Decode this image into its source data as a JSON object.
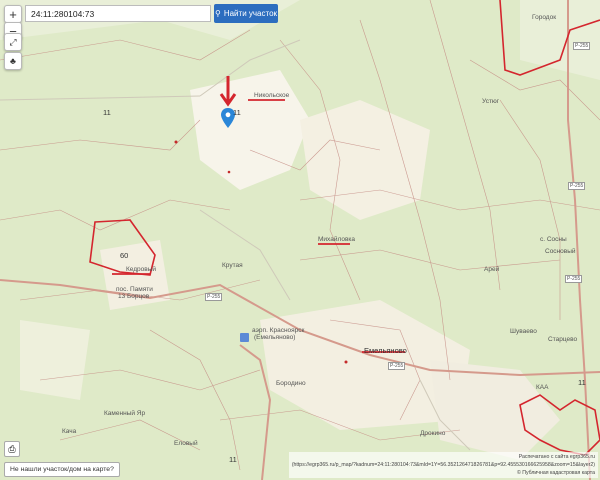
{
  "search": {
    "value": "24:11:280104:73"
  },
  "find_button": {
    "label": "Найти участок",
    "icon": "search-icon"
  },
  "controls": {
    "zoom_in": "+",
    "zoom_out": "−",
    "fullscreen_icon": "expand-icon",
    "layers_icon": "layers-icon"
  },
  "map_labels": {
    "nikolskoe": "Никольское",
    "mikhaylovka": "Михайловка",
    "kedrovy": "Кедровый",
    "krutaya": "Крутая",
    "pos_pamyati": "пос. Памяти",
    "borcov": "13 Борцов",
    "airport": "аэрп. Красноярск",
    "airport2": "(Емельяново)",
    "emelyanovo": "Емельяново",
    "ustyug": "Устюг",
    "sosny": "с. Сосны",
    "sosnovy": "Сосновый",
    "arey": "Арей",
    "shuvaevo": "Шуваево",
    "starcevo": "Старцево",
    "borodino": "Бородино",
    "drokino": "Дрокино",
    "kamenniy_yar": "Каменный Яр",
    "yelovyy": "Еловый",
    "kacha": "Кача",
    "gorodok": "Городок",
    "kaaa": "КАА"
  },
  "region_numbers": {
    "a": "11",
    "b": "60",
    "c": "11",
    "d": "11",
    "e": "11"
  },
  "road_labels": {
    "r1": "Р-255",
    "r2": "Р-255",
    "r3": "Р-255",
    "r4": "Р-255",
    "r5": "Р-255"
  },
  "attribution": {
    "line1": "Распечатано с сайта egrp365.ru",
    "line2": "(https://egrp365.ru/p_map/?kadnum=24:11:280104:73&mId=1Y=56.352126471826781&p=92.455530166625958&zoom=15&layer2)",
    "line3": "© Публичная кадастровая карта"
  },
  "bottom_button": {
    "label": "Не нашли участок/дом на карте?"
  },
  "colors": {
    "accent": "#2c6dbf",
    "boundary": "#d4262e",
    "road": "#c67a6a",
    "marker": "#2a86d8"
  }
}
